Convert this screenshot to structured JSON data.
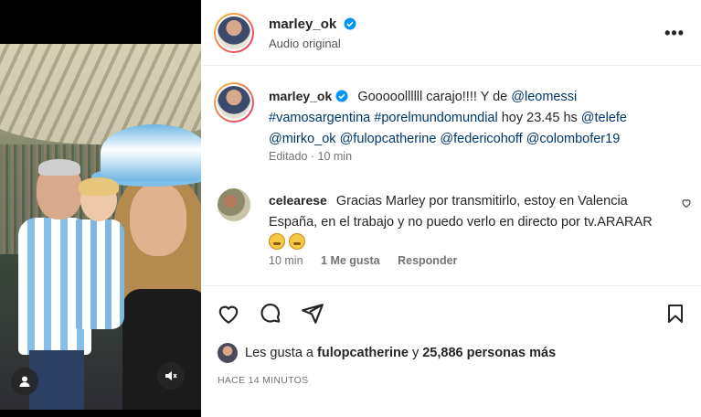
{
  "post": {
    "author": "marley_ok",
    "audio": "Audio original",
    "more_label": "•••"
  },
  "caption": {
    "author": "marley_ok",
    "text_parts": [
      {
        "text": "Gooooollllll carajo!!!! Y de ",
        "tag": false
      },
      {
        "text": "@leomessi",
        "tag": true
      },
      {
        "text": " ",
        "tag": false
      },
      {
        "text": "#vamosargentina",
        "tag": true
      },
      {
        "text": " ",
        "tag": false
      },
      {
        "text": "#porelmundomundial",
        "tag": true
      },
      {
        "text": " hoy 23.45 hs ",
        "tag": false
      },
      {
        "text": "@telefe",
        "tag": true
      },
      {
        "text": " ",
        "tag": false
      },
      {
        "text": "@mirko_ok",
        "tag": true
      },
      {
        "text": " ",
        "tag": false
      },
      {
        "text": "@fulopcatherine",
        "tag": true
      },
      {
        "text": " ",
        "tag": false
      },
      {
        "text": "@federicohoff",
        "tag": true
      },
      {
        "text": " ",
        "tag": false
      },
      {
        "text": "@colombofer19",
        "tag": true
      }
    ],
    "meta": "Editado · 10 min"
  },
  "comment": {
    "author": "celearese",
    "text": "Gracias Marley por transmitirlo, estoy en Valencia España, en el trabajo y no puedo verlo en directo por tv.ARARAR",
    "time": "10 min",
    "likes": "1 Me gusta",
    "reply": "Responder"
  },
  "likes": {
    "prefix": "Les gusta a ",
    "user": "fulopcatherine",
    "middle": " y ",
    "count": "25,886 personas más"
  },
  "time_ago": "HACE 14 MINUTOS",
  "icons": {
    "verified": "verified-badge-icon",
    "like": "heart-icon",
    "comment": "comment-bubble-icon",
    "share": "paper-plane-icon",
    "save": "bookmark-icon",
    "user_tag": "user-icon",
    "mute": "speaker-muted-icon"
  },
  "colors": {
    "accent": "#0095f6",
    "tag": "#00376b",
    "muted": "#737373"
  }
}
